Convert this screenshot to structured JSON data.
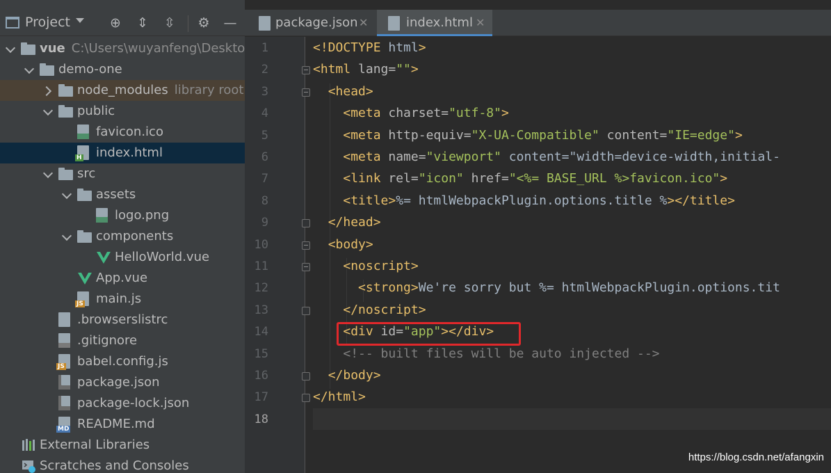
{
  "sidebar": {
    "title": "Project",
    "toolbar_icons": [
      "locate-icon",
      "expand-all-icon",
      "collapse-all-icon",
      "gear-icon",
      "hide-icon"
    ],
    "tree": [
      {
        "label": "vue",
        "path": "C:\\Users\\wuyanfeng\\Desktop\\",
        "kind": "folder",
        "expanded": true,
        "bold": true
      },
      {
        "label": "demo-one",
        "kind": "folder",
        "expanded": true
      },
      {
        "label": "node_modules",
        "hint": "library root",
        "kind": "folder",
        "expanded": false
      },
      {
        "label": "public",
        "kind": "folder",
        "expanded": true
      },
      {
        "label": "favicon.ico",
        "kind": "image-file"
      },
      {
        "label": "index.html",
        "kind": "html-file",
        "selected": true
      },
      {
        "label": "src",
        "kind": "folder",
        "expanded": true
      },
      {
        "label": "assets",
        "kind": "folder",
        "expanded": true
      },
      {
        "label": "logo.png",
        "kind": "image-file"
      },
      {
        "label": "components",
        "kind": "folder",
        "expanded": true
      },
      {
        "label": "HelloWorld.vue",
        "kind": "vue-file"
      },
      {
        "label": "App.vue",
        "kind": "vue-file"
      },
      {
        "label": "main.js",
        "kind": "js-file"
      },
      {
        "label": ".browserslistrc",
        "kind": "text-file"
      },
      {
        "label": ".gitignore",
        "kind": "ignore-file"
      },
      {
        "label": "babel.config.js",
        "kind": "js-file"
      },
      {
        "label": "package.json",
        "kind": "json-file"
      },
      {
        "label": "package-lock.json",
        "kind": "json-file"
      },
      {
        "label": "README.md",
        "kind": "md-file"
      },
      {
        "label": "External Libraries",
        "kind": "libraries"
      },
      {
        "label": "Scratches and Consoles",
        "kind": "scratches"
      }
    ]
  },
  "tabs": [
    {
      "label": "package.json",
      "active": false
    },
    {
      "label": "index.html",
      "active": true
    }
  ],
  "editor": {
    "line_numbers": [
      "1",
      "2",
      "3",
      "4",
      "5",
      "6",
      "7",
      "8",
      "9",
      "10",
      "11",
      "12",
      "13",
      "14",
      "15",
      "16",
      "17",
      "18"
    ],
    "current_line": "18",
    "lines": [
      "<!DOCTYPE html>",
      "<html lang=\"\">",
      "  <head>",
      "    <meta charset=\"utf-8\">",
      "    <meta http-equiv=\"X-UA-Compatible\" content=\"IE=edge\">",
      "    <meta name=\"viewport\" content=\"width=device-width,initial-",
      "    <link rel=\"icon\" href=\"<%= BASE_URL %>favicon.ico\">",
      "    <title><%= htmlWebpackPlugin.options.title %></title>",
      "  </head>",
      "  <body>",
      "    <noscript>",
      "      <strong>We're sorry but <%= htmlWebpackPlugin.options.tit",
      "    </noscript>",
      "    <div id=\"app\"></div>",
      "    <!-- built files will be auto injected -->",
      "  </body>",
      "</html>",
      ""
    ]
  },
  "annotation": {
    "highlight_color": "#e0282b"
  },
  "watermark": "https://blog.csdn.net/afangxin"
}
